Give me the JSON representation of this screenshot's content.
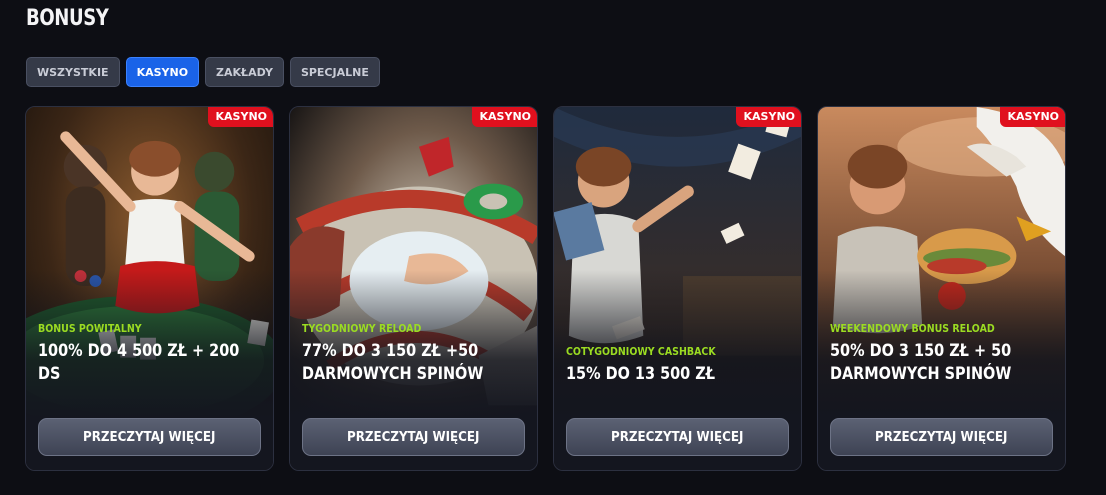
{
  "page": {
    "title": "BONUSY"
  },
  "filters": [
    {
      "label": "WSZYSTKIE",
      "active": false
    },
    {
      "label": "KASYNO",
      "active": true
    },
    {
      "label": "ZAKŁADY",
      "active": false
    },
    {
      "label": "SPECJALNE",
      "active": false
    }
  ],
  "cards": [
    {
      "badge": "KASYNO",
      "category": "BONUS POWITALNY",
      "offer": "100% DO 4 500 ZŁ + 200 DS",
      "button": "PRZECZYTAJ WIĘCEJ",
      "image": "casino-poker-table-celebration"
    },
    {
      "badge": "KASYNO",
      "category": "TYGODNIOWY RELOAD",
      "offer": "77% DO 3 150 ZŁ +50 DARMOWYCH SPINÓW",
      "button": "PRZECZYTAJ WIĘCEJ",
      "image": "water-slide-swim-ring"
    },
    {
      "badge": "KASYNO",
      "category": "COTYGODNIOWY CASHBACK",
      "offer": "15% DO 13 500 ZŁ",
      "button": "PRZECZYTAJ WIĘCEJ",
      "image": "man-holding-cash-tickets"
    },
    {
      "badge": "KASYNO",
      "category": "WEEKENDOWY BONUS RELOAD",
      "offer": "50% DO 3 150 ZŁ + 50 DARMOWYCH SPINÓW",
      "button": "PRZECZYTAJ WIĘCEJ",
      "image": "man-eating-sandwich-seagull"
    }
  ],
  "colors": {
    "accent": "#1a63e8",
    "badge": "#e0101e",
    "category": "#9bdc22",
    "background": "#0d0e14"
  }
}
